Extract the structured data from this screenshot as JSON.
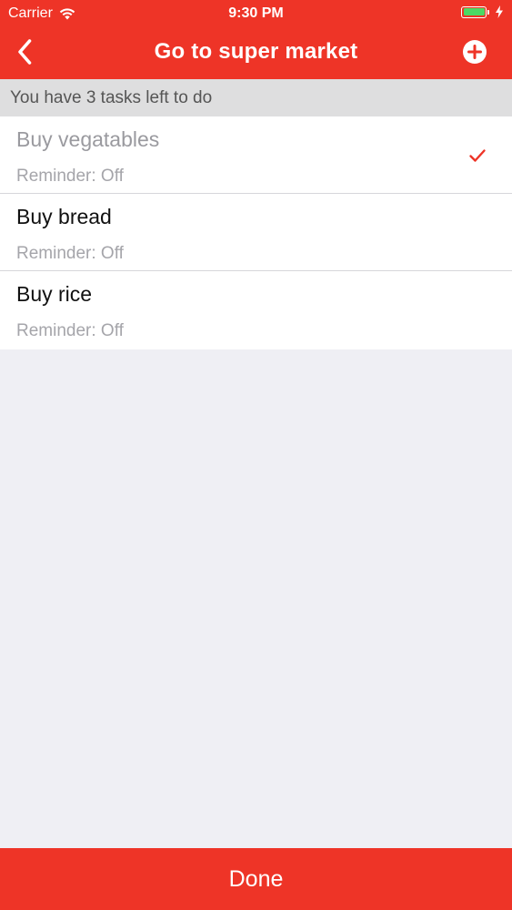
{
  "status_bar": {
    "carrier": "Carrier",
    "time": "9:30 PM",
    "battery_color": "#4cd964"
  },
  "nav": {
    "title": "Go to super market",
    "back_icon": "chevron-left-icon",
    "add_icon": "plus-circle-icon",
    "bar_color": "#ee3427"
  },
  "summary": {
    "text": "You have 3 tasks left to do"
  },
  "tasks": [
    {
      "title": "Buy vegatables",
      "reminder": "Reminder: Off",
      "completed": true
    },
    {
      "title": "Buy bread",
      "reminder": "Reminder: Off",
      "completed": false
    },
    {
      "title": "Buy rice",
      "reminder": "Reminder: Off",
      "completed": false
    }
  ],
  "footer": {
    "done_label": "Done"
  }
}
